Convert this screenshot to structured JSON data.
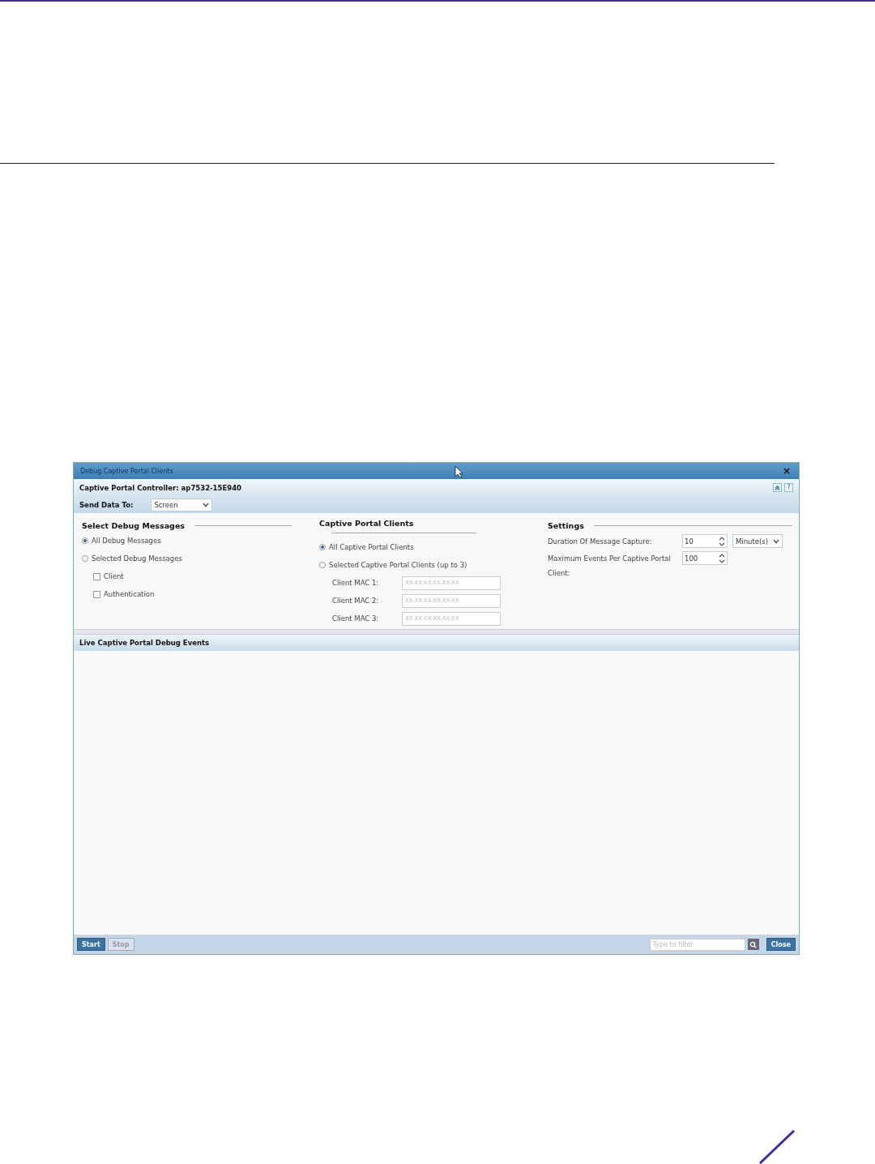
{
  "window": {
    "title": "Debug Captive Portal Clients",
    "close": "×"
  },
  "controller": {
    "label": "Captive Portal Controller: ap7532-15E940",
    "buttons": [
      {
        "kind": "collapse"
      },
      {
        "kind": "help",
        "label": "?"
      }
    ]
  },
  "send_data": {
    "label": "Send Data To:",
    "value": "Screen"
  },
  "select_debug_messages": {
    "title": "Select Debug Messages",
    "options": [
      {
        "label": "All Debug Messages",
        "selected": true
      },
      {
        "label": "Selected Debug Messages",
        "selected": false
      }
    ],
    "checkboxes": [
      {
        "label": "Client",
        "checked": false
      },
      {
        "label": "Authentication",
        "checked": false
      }
    ]
  },
  "captive_portal_clients": {
    "title": "Captive Portal Clients",
    "options": [
      {
        "label": "All Captive Portal Clients",
        "selected": true
      },
      {
        "label": "Selected Captive Portal Clients (up to 3)",
        "selected": false
      }
    ],
    "mac_fields": [
      {
        "label": "Client MAC 1:",
        "placeholder": "XX-XX-XX-XX-XX-XX"
      },
      {
        "label": "Client MAC 2:",
        "placeholder": "XX-XX-XX-XX-XX-XX"
      },
      {
        "label": "Client MAC 3:",
        "placeholder": "XX-XX-XX-XX-XX-XX"
      }
    ]
  },
  "settings": {
    "title": "Settings",
    "rows": [
      {
        "label": "Duration Of Message Capture:",
        "value": "10",
        "unit": "Minute(s)"
      },
      {
        "label": "Maximum Events Per Captive Portal Client:",
        "value": "100"
      }
    ]
  },
  "events": {
    "title": "Live Captive Portal Debug Events"
  },
  "footer": {
    "buttons": [
      {
        "label": "Start",
        "disabled": false
      },
      {
        "label": "Stop",
        "disabled": true
      }
    ],
    "filter": {
      "placeholder": "Type to filter"
    },
    "close": "Close"
  }
}
